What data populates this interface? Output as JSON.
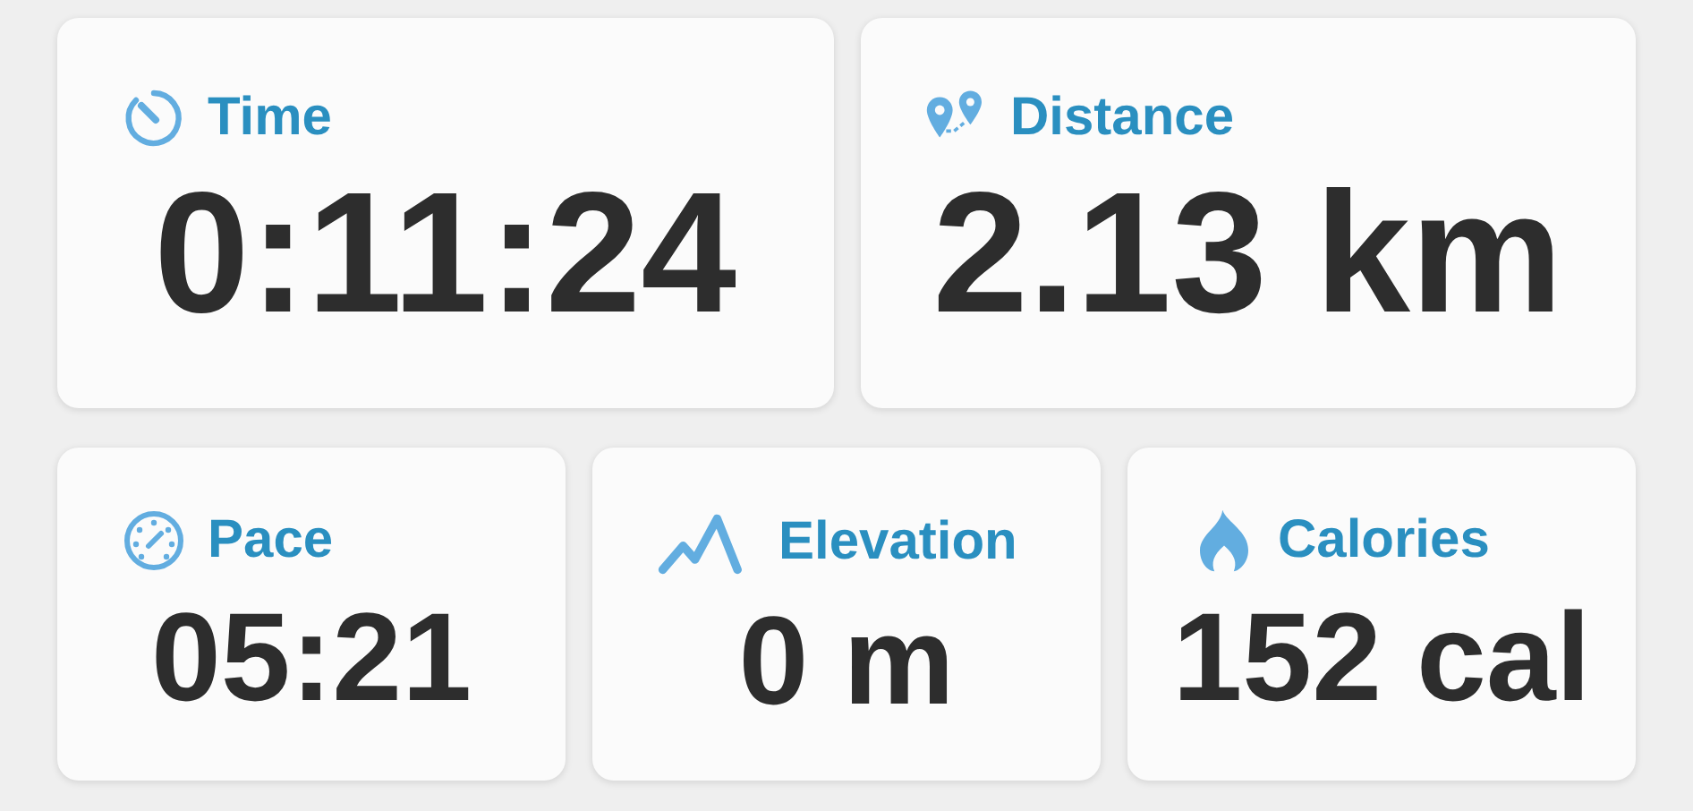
{
  "rows": [
    {
      "cards": [
        {
          "kind": "time",
          "label": "Time",
          "value": "0:11:24"
        },
        {
          "kind": "distance",
          "label": "Distance",
          "value": "2.13 km"
        }
      ]
    },
    {
      "cards": [
        {
          "kind": "pace",
          "label": "Pace",
          "value": "05:21"
        },
        {
          "kind": "elevation",
          "label": "Elevation",
          "value": "0 m"
        },
        {
          "kind": "calories",
          "label": "Calories",
          "value": "152 cal"
        }
      ]
    }
  ]
}
